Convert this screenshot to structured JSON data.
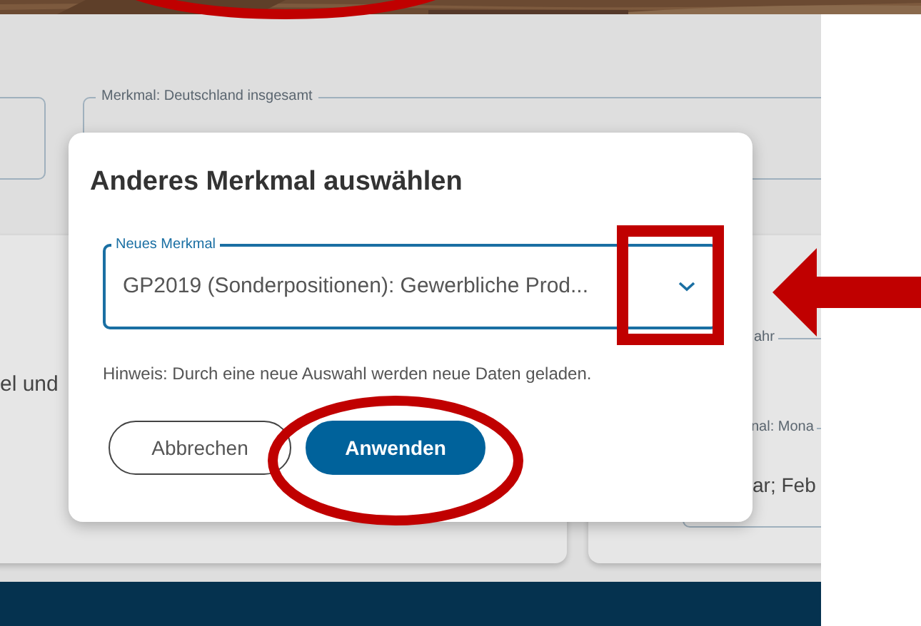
{
  "page": {
    "top_field_legend": "Merkmal: Deutschland insgesamt",
    "left_card_text": "el und",
    "right_card_legend": "ahr",
    "right_field_label": "nal: Mona",
    "right_field_value": "ar; Feb"
  },
  "dialog": {
    "title": "Anderes Merkmal auswählen",
    "select": {
      "label": "Neues Merkmal",
      "value": "GP2019 (Sonderpositionen): Gewerbliche Prod..."
    },
    "hint": "Hinweis: Durch eine neue Auswahl werden neue Daten geladen.",
    "buttons": [
      {
        "label": "Abbrechen",
        "kind": "secondary"
      },
      {
        "label": "Anwenden",
        "kind": "primary"
      }
    ]
  },
  "annotations": [
    {
      "kind": "ellipse"
    },
    {
      "kind": "rectangle"
    },
    {
      "kind": "arrow"
    },
    {
      "kind": "ellipse"
    }
  ]
}
